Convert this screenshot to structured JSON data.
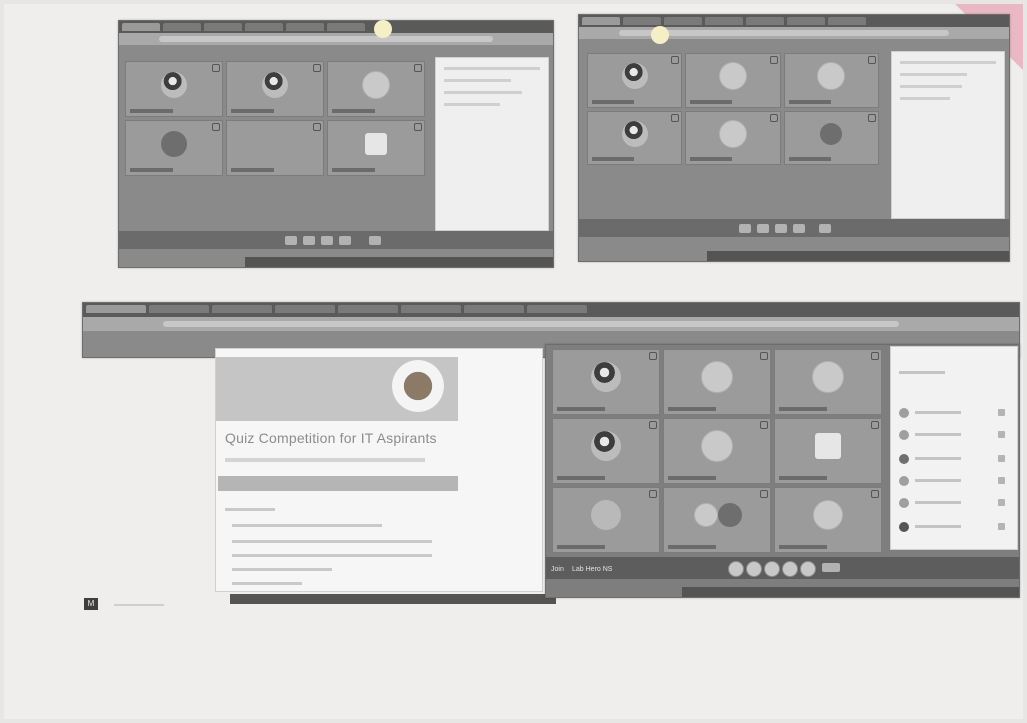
{
  "document": {
    "quiz_title": "Quiz Competition for IT Aspirants",
    "stray_badge": "M"
  },
  "meeting_bottom": {
    "left_label": "Join",
    "name_label": "Lab Hero NS"
  },
  "screenshots": [
    {
      "id": "top-left",
      "participants_visible": 6
    },
    {
      "id": "top-right",
      "participants_visible": 6
    },
    {
      "id": "bottom-right",
      "participants_visible": 9
    }
  ],
  "colors": {
    "paper": "#efeeec",
    "window_chrome": "#5a5a5a",
    "tile": "#9b9b9b",
    "panel": "#efefef",
    "corner_tab": "#e9b8c4"
  },
  "icons": [
    "video-tile-pin-icon",
    "mic-button-icon",
    "camera-button-icon",
    "end-call-button-icon",
    "participant-avatar-icon"
  ]
}
